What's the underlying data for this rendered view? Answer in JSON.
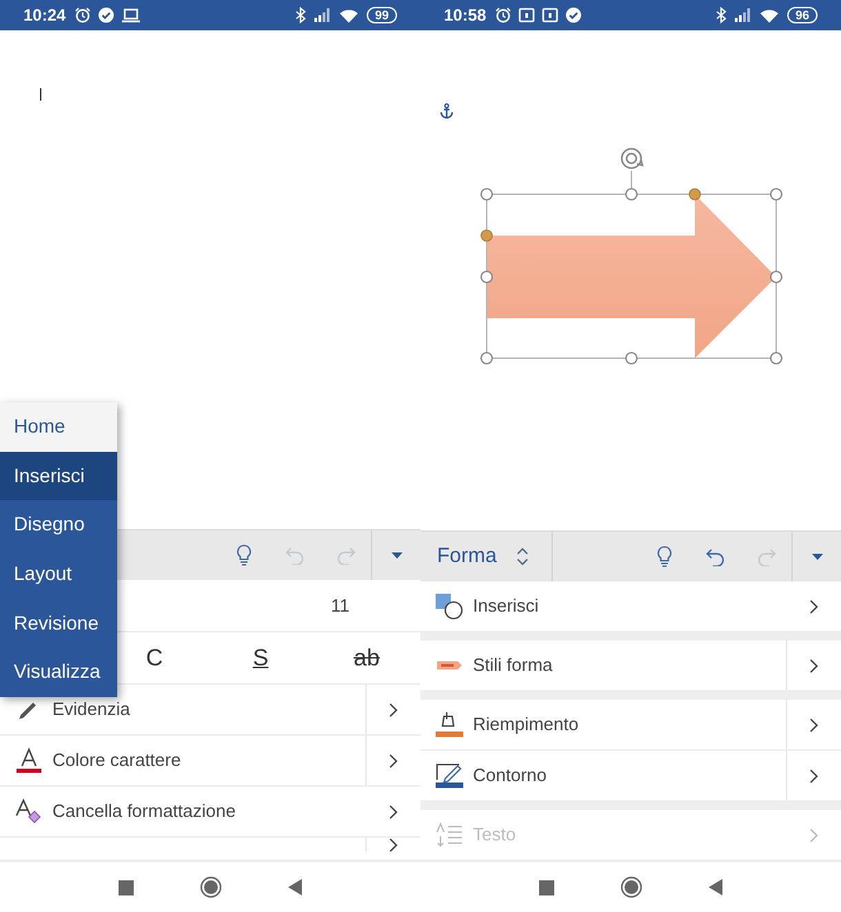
{
  "phones": [
    {
      "status_bar": {
        "time": "10:24",
        "notification_icons": [
          {
            "kind": "alarm"
          },
          {
            "kind": "check"
          },
          {
            "kind": "laptop"
          }
        ],
        "battery": "99"
      },
      "document": {
        "kind": "text-cursor"
      },
      "tab_menu": [
        {
          "label": "Home",
          "selected": false
        },
        {
          "label": "Inserisci",
          "selected": true
        },
        {
          "label": "Disegno",
          "selected": false
        },
        {
          "label": "Layout",
          "selected": false
        },
        {
          "label": "Revisione",
          "selected": false
        },
        {
          "label": "Visualizza",
          "selected": false
        }
      ],
      "toolbar": {
        "undo_disabled": true,
        "redo_disabled": true
      },
      "font_size": "11",
      "format_buttons": [
        {
          "label": "C",
          "kind": "italic"
        },
        {
          "label": "S",
          "kind": "underline"
        },
        {
          "label": "ab",
          "kind": "strikethrough"
        }
      ],
      "rows": [
        {
          "label": "Evidenzia",
          "kind": "highlighter",
          "submenu": true,
          "disabled": false
        },
        {
          "label": "Colore carattere",
          "kind": "font-color",
          "submenu": true,
          "disabled": false
        },
        {
          "label": "Cancella formattazione",
          "kind": "clear-format",
          "submenu": false,
          "disabled": false
        },
        {
          "kind": "partial",
          "submenu": true
        }
      ]
    },
    {
      "status_bar": {
        "time": "10:58",
        "notification_icons": [
          {
            "kind": "alarm"
          },
          {
            "kind": "box"
          },
          {
            "kind": "box"
          },
          {
            "kind": "check"
          }
        ],
        "battery": "96"
      },
      "document": {
        "kind": "shape"
      },
      "toolbar": {
        "title": "Forma",
        "undo_disabled": false,
        "redo_disabled": true
      },
      "rows": [
        {
          "label": "Inserisci",
          "kind": "insert-shape",
          "submenu": false,
          "disabled": false
        },
        {
          "label": "Stili forma",
          "kind": "shape-styles",
          "submenu": true,
          "disabled": false,
          "gap_before": true
        },
        {
          "label": "Riempimento",
          "kind": "fill",
          "submenu": true,
          "disabled": false,
          "gap_before": true
        },
        {
          "label": "Contorno",
          "kind": "outline",
          "submenu": true,
          "disabled": false
        },
        {
          "label": "Testo",
          "kind": "text",
          "submenu": false,
          "disabled": true,
          "gap_before": true
        }
      ]
    }
  ]
}
